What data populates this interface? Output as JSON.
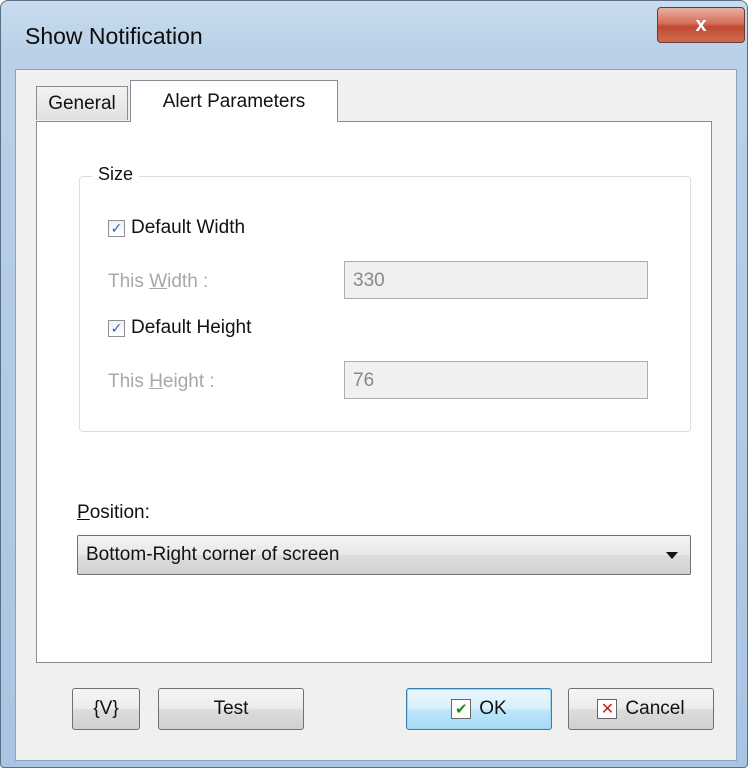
{
  "window": {
    "title": "Show Notification",
    "close_glyph": "x"
  },
  "tabs": [
    {
      "label": "General",
      "active": false
    },
    {
      "label": "Alert Parameters",
      "active": true
    }
  ],
  "size_group": {
    "legend": "Size",
    "default_width": {
      "label": "Default Width",
      "checked": true
    },
    "width_field": {
      "label_prefix": "This ",
      "label_accel": "W",
      "label_rest": "idth :",
      "value": "330",
      "enabled": false
    },
    "default_height": {
      "label": "Default Height",
      "checked": true
    },
    "height_field": {
      "label_prefix": "This ",
      "label_accel": "H",
      "label_rest": "eight :",
      "value": "76",
      "enabled": false
    }
  },
  "position": {
    "label_accel": "P",
    "label_rest": "osition:",
    "selected": "Bottom-Right corner of screen"
  },
  "buttons": {
    "variables": "{V}",
    "test": "Test",
    "ok": "OK",
    "cancel": "Cancel"
  },
  "icons": {
    "check_glyph": "✔",
    "checkbox_glyph": "✓",
    "cancel_glyph": "✕"
  }
}
